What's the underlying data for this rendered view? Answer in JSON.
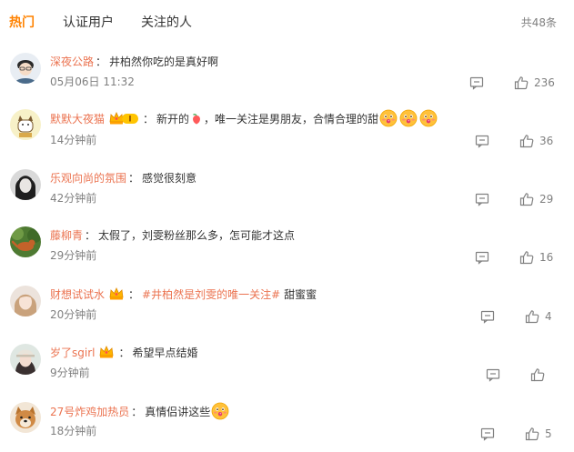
{
  "tabs": [
    {
      "label": "热门"
    },
    {
      "label": "认证用户"
    },
    {
      "label": "关注的人"
    }
  ],
  "total": "共48条",
  "comments": [
    {
      "user": "深夜公路",
      "text": "井柏然你吃的是真好啊",
      "time": "05月06日 11:32",
      "likes": "236"
    },
    {
      "user": "默默大夜猫",
      "text_before": "新开的",
      "text_after": "，唯一关注是男朋友，合情合理的甜",
      "time": "14分钟前",
      "likes": "36"
    },
    {
      "user": "乐观向尚的氛围",
      "text": "感觉很刻意",
      "time": "42分钟前",
      "likes": "29"
    },
    {
      "user": "藤柳青",
      "text": "太假了，刘雯粉丝那么多，怎可能才这点",
      "time": "29分钟前",
      "likes": "16"
    },
    {
      "user": "财想试试水",
      "hashtag": "#井柏然是刘雯的唯一关注#",
      "text": "甜蜜蜜",
      "time": "20分钟前",
      "likes": "4"
    },
    {
      "user": "岁了sgirl",
      "text": "希望早点结婚",
      "time": "9分钟前",
      "likes": ""
    },
    {
      "user": "27号炸鸡加热员",
      "text": "真情侣讲这些",
      "time": "18分钟前",
      "likes": "5"
    }
  ],
  "icons": {
    "comment": "comment-icon",
    "like": "thumbs-up-icon",
    "emoji": "flushed-face-emoji",
    "crown": "crown-badge-icon"
  },
  "colors": {
    "accent": "#ff8200",
    "username": "#eb7350",
    "meta": "#808080",
    "text": "#333333"
  }
}
